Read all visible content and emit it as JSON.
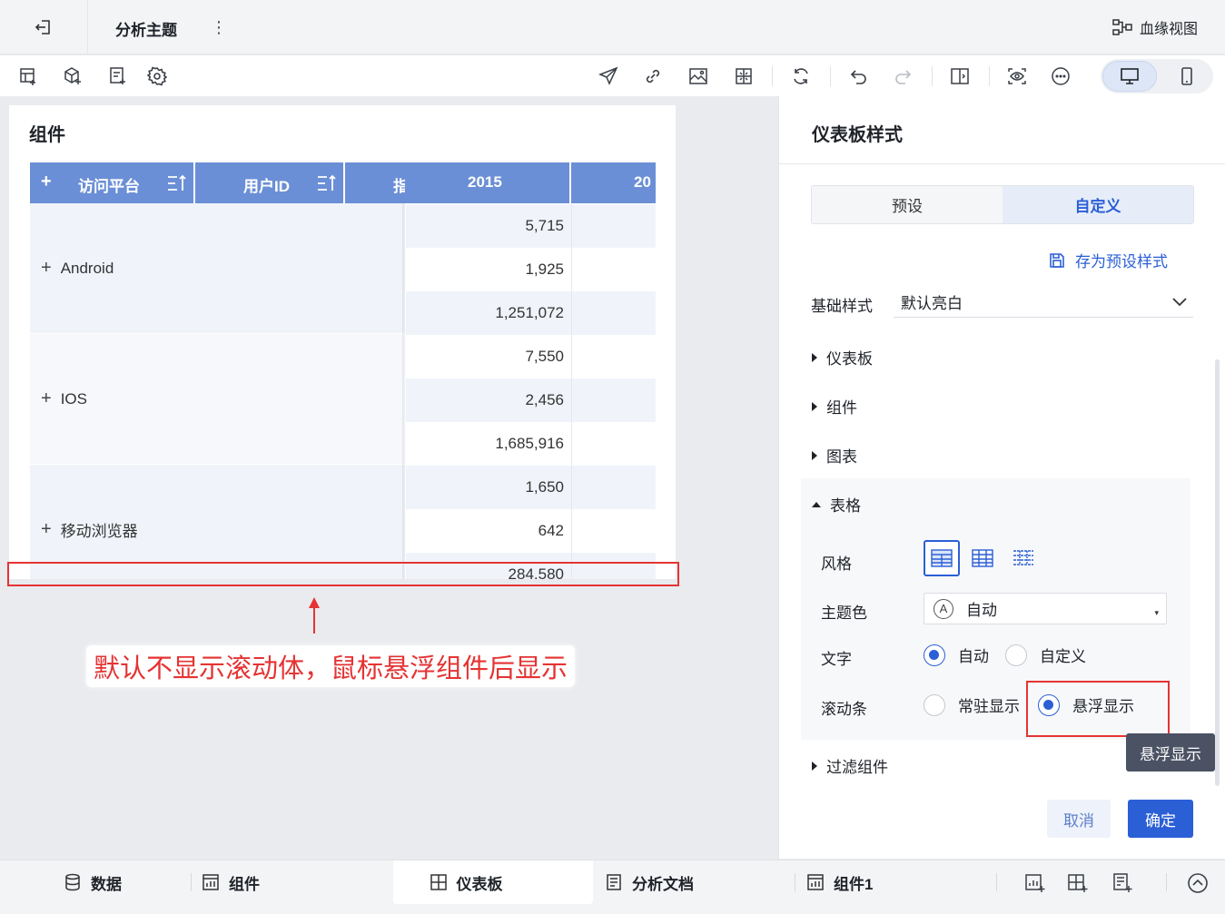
{
  "header": {
    "title": "分析主题",
    "lineage_label": "血缘视图"
  },
  "widget": {
    "title": "组件",
    "columns": {
      "platform": "访问平台",
      "userid": "用户ID",
      "clipped": "指",
      "year1": "2015",
      "year2": "20"
    },
    "rows": [
      {
        "platform": "Android",
        "values": [
          "5,715",
          "1,925",
          "1,251,072"
        ]
      },
      {
        "platform": "IOS",
        "values": [
          "7,550",
          "2,456",
          "1,685,916"
        ]
      },
      {
        "platform": "移动浏览器",
        "values": [
          "1,650",
          "642",
          "284,580"
        ]
      }
    ],
    "plus": "+"
  },
  "annotation": {
    "text": "默认不显示滚动体，鼠标悬浮组件后显示"
  },
  "panel": {
    "title": "仪表板样式",
    "tabs": [
      "预设",
      "自定义"
    ],
    "active_tab": "自定义",
    "save_preset": "存为预设样式",
    "base_style_label": "基础样式",
    "base_style_value": "默认亮白",
    "sections": {
      "dashboard": "仪表板",
      "component": "组件",
      "chart": "图表",
      "table": "表格",
      "filter": "过滤组件"
    },
    "table": {
      "style_label": "风格",
      "theme_label": "主题色",
      "theme_value": "自动",
      "theme_icon_letter": "A",
      "text_label": "文字",
      "text_options": [
        "自动",
        "自定义"
      ],
      "scroll_label": "滚动条",
      "scroll_options": [
        "常驻显示",
        "悬浮显示"
      ]
    },
    "tooltip": "悬浮显示",
    "cancel": "取消",
    "confirm": "确定"
  },
  "bottom_tabs": [
    "数据",
    "组件",
    "仪表板",
    "分析文档",
    "组件1"
  ],
  "colors": {
    "accent": "#2b5fd6",
    "header_blue": "#6b8fd6",
    "annotation_red": "#e53333"
  }
}
